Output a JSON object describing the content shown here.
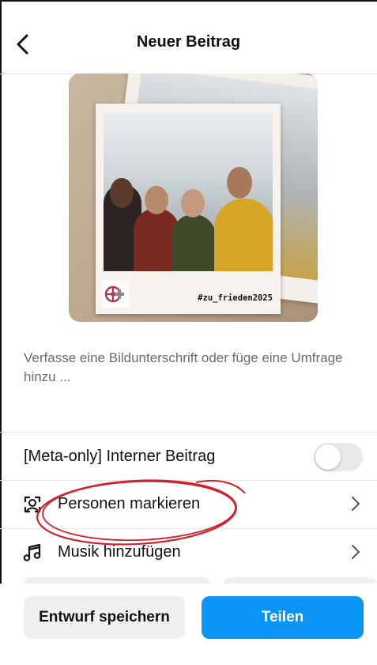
{
  "header": {
    "title": "Neuer Beitrag",
    "back_icon": "chevron-left-icon"
  },
  "media": {
    "hashtag": "#zu_frieden2025",
    "logo_icon": "wheel-cross-logo"
  },
  "caption": {
    "placeholder": "Verfasse eine Bildunterschrift oder füge eine Umfrage hinzu ..."
  },
  "options": {
    "internal_post": {
      "label": "[Meta-only] Interner Beitrag",
      "toggle_on": false
    },
    "tag_people": {
      "label": "Personen markieren",
      "icon": "person-tag-icon"
    },
    "add_music": {
      "label": "Musik hinzufügen",
      "icon": "music-note-icon"
    }
  },
  "footer": {
    "draft_label": "Entwurf speichern",
    "share_label": "Teilen"
  },
  "colors": {
    "accent": "#0a95f6",
    "annotation": "#d0202a"
  }
}
